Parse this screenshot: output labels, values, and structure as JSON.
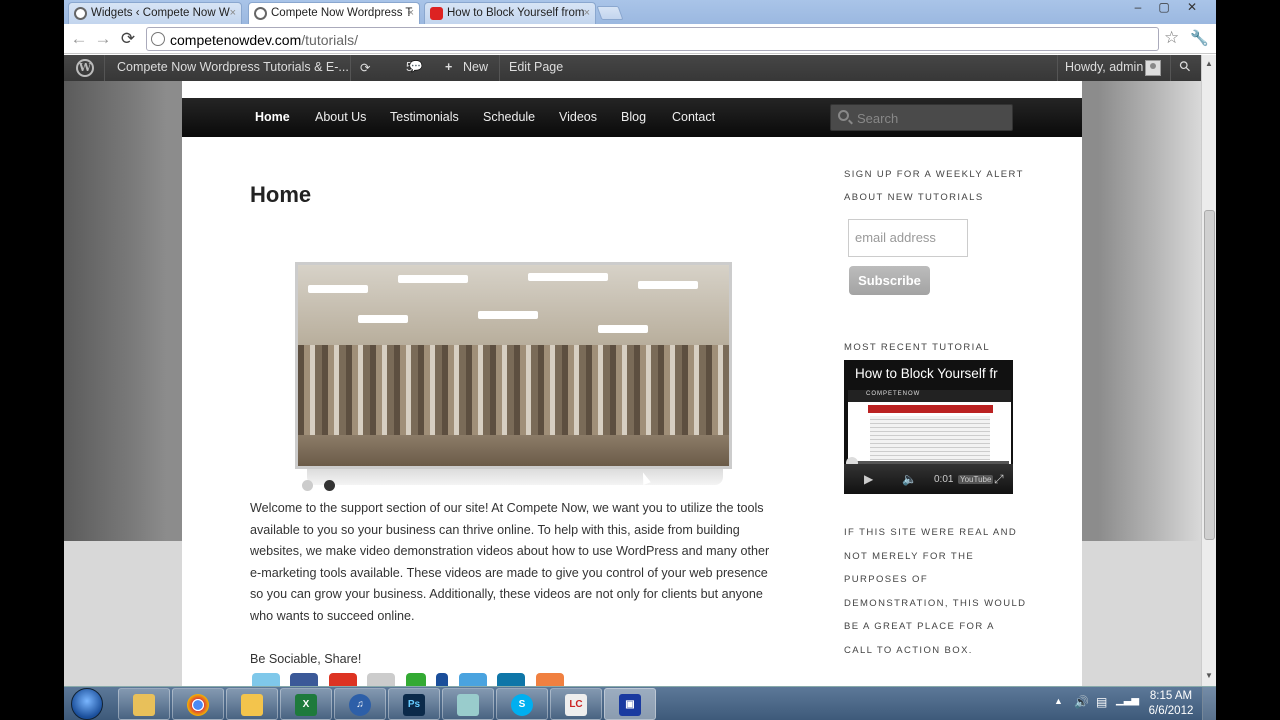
{
  "browser": {
    "tabs": [
      {
        "title": "Widgets ‹ Compete Now W",
        "active": false,
        "icon": "wordpress-icon"
      },
      {
        "title": "Compete Now Wordpress T",
        "active": true,
        "icon": "wordpress-icon"
      },
      {
        "title": "How to Block Yourself from",
        "active": false,
        "icon": "youtube-icon"
      }
    ],
    "close_glyph": "×",
    "window_controls": {
      "minimize": "–",
      "maximize": "▢",
      "close": "✕"
    },
    "url_domain": "competenowdev.com",
    "url_path": "/tutorials/",
    "back": "←",
    "forward": "→",
    "reload": "⟳",
    "star": "☆",
    "wrench": "🔧"
  },
  "adminbar": {
    "logo": "W",
    "site_name": "Compete Now Wordpress Tutorials & E-...",
    "updates_count": "5",
    "updates_icon": "⟳",
    "comments_icon": "💬",
    "new_label": "New",
    "new_icon": "+",
    "edit_label": "Edit Page",
    "howdy": "Howdy, admin",
    "search_icon": "⚲"
  },
  "site": {
    "menu": [
      "Home",
      "About Us",
      "Testimonials",
      "Schedule",
      "Videos",
      "Blog",
      "Contact"
    ],
    "search_placeholder": "Search",
    "page_title": "Home",
    "intro": "Welcome to the support section of our site! At Compete Now, we want you to utilize the tools available to you so your business can thrive online. To help with this, aside from building websites, we make video demonstration videos about how to use WordPress and many other e-marketing tools available. These videos are made to give you control of your web presence so you can grow your business. Additionally, these videos are not only for clients but anyone who wants to succeed online.",
    "sociable": "Be Sociable, Share!"
  },
  "sidebar": {
    "signup_title_line1": "SIGN UP FOR A WEEKLY ALERT",
    "signup_title_line2": "ABOUT NEW TUTORIALS",
    "email_placeholder": "email address",
    "subscribe_label": "Subscribe",
    "recent_title": "MOST RECENT TUTORIAL",
    "video_title": "How to Block Yourself fr",
    "video_brand": "COMPETENOW",
    "video_time": "0:01",
    "video_logo": "YouTube",
    "cta_lines": [
      "IF THIS SITE WERE REAL AND",
      "NOT MERELY FOR THE",
      "PURPOSES OF",
      "DEMONSTRATION, THIS WOULD",
      "BE A GREAT PLACE FOR A",
      "CALL TO ACTION BOX."
    ]
  },
  "taskbar": {
    "apps": [
      {
        "name": "windows-explorer",
        "label": ""
      },
      {
        "name": "chrome",
        "label": ""
      },
      {
        "name": "outlook",
        "label": ""
      },
      {
        "name": "excel",
        "label": "X"
      },
      {
        "name": "itunes",
        "label": "♫"
      },
      {
        "name": "photoshop",
        "label": "Ps"
      },
      {
        "name": "notepad",
        "label": ""
      },
      {
        "name": "skype",
        "label": "S"
      },
      {
        "name": "lc-app",
        "label": "LC"
      },
      {
        "name": "recorder",
        "label": "▣"
      }
    ],
    "time": "8:15 AM",
    "date": "6/6/2012",
    "tray_arrow": "▲"
  },
  "colors": {
    "adminbar": "#3c3c3c",
    "menubar": "#111111",
    "youtube": "#d22222"
  }
}
